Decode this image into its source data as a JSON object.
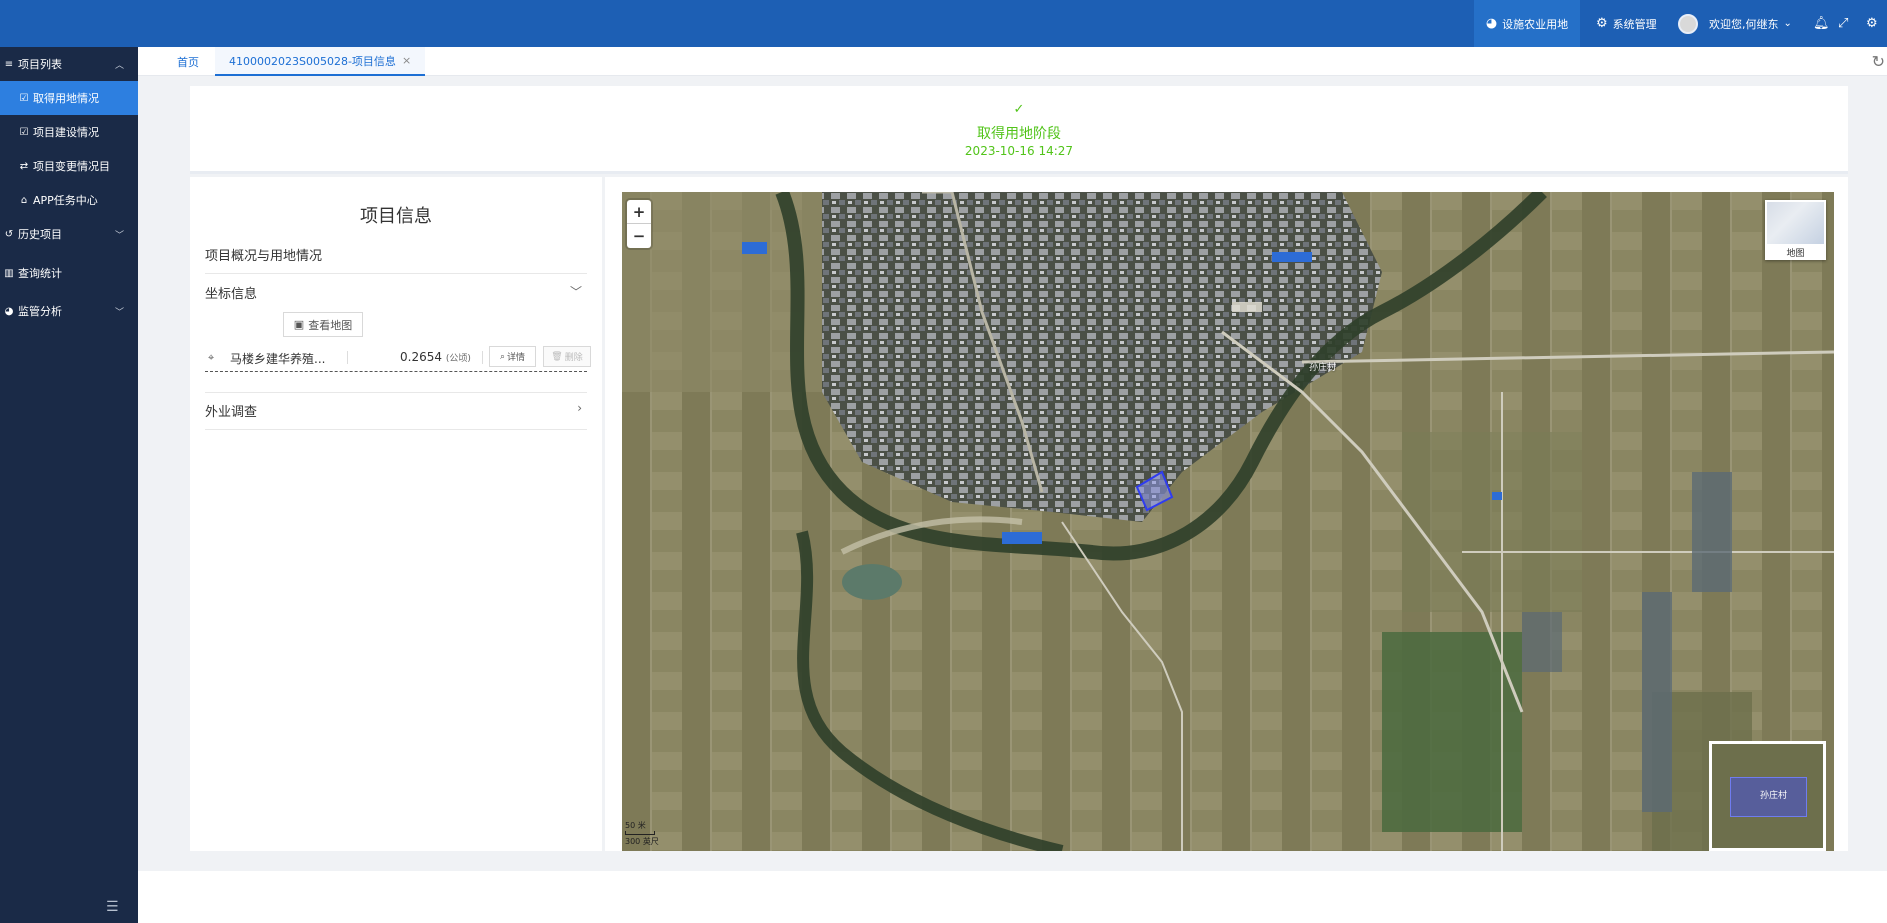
{
  "header": {
    "nav_active": "设施农业用地",
    "nav_system": "系统管理",
    "user_greeting": "欢迎您,何继东"
  },
  "sidebar": {
    "items": [
      {
        "label": "项目列表"
      },
      {
        "label": "取得用地情况"
      },
      {
        "label": "项目建设情况"
      },
      {
        "label": "项目变更情况目"
      },
      {
        "label": "APP任务中心"
      },
      {
        "label": "历史项目"
      },
      {
        "label": "查询统计"
      },
      {
        "label": "监管分析"
      }
    ]
  },
  "tabs": {
    "home": "首页",
    "current": "4100002023S005028-项目信息",
    "close_glyph": "×"
  },
  "stage": {
    "title": "取得用地阶段",
    "date": "2023-10-16 14:27"
  },
  "project_info": {
    "title": "项目信息",
    "overview": "项目概况与用地情况",
    "coordinates_label": "坐标信息",
    "view_map_button": "查看地图",
    "plot": {
      "name": "马楼乡建华养殖...",
      "area": "0.2654",
      "unit": "(公顷)",
      "detail_button": "详情",
      "delete_button": "删除"
    },
    "field_survey_label": "外业调查"
  },
  "map": {
    "zoom_in": "+",
    "zoom_out": "−",
    "layer_switch_label": "地图",
    "village_label": "孙庄村",
    "overview_label": "孙庄村",
    "scale_m": "50 米",
    "scale_ft": "300 英尺"
  },
  "colors": {
    "header_bg": "#1d5fb4",
    "sidebar_bg": "#1a2a47",
    "sidebar_active": "#2d7fe0",
    "stage_green": "#52c41a",
    "tab_blue": "#1d6fd4"
  }
}
